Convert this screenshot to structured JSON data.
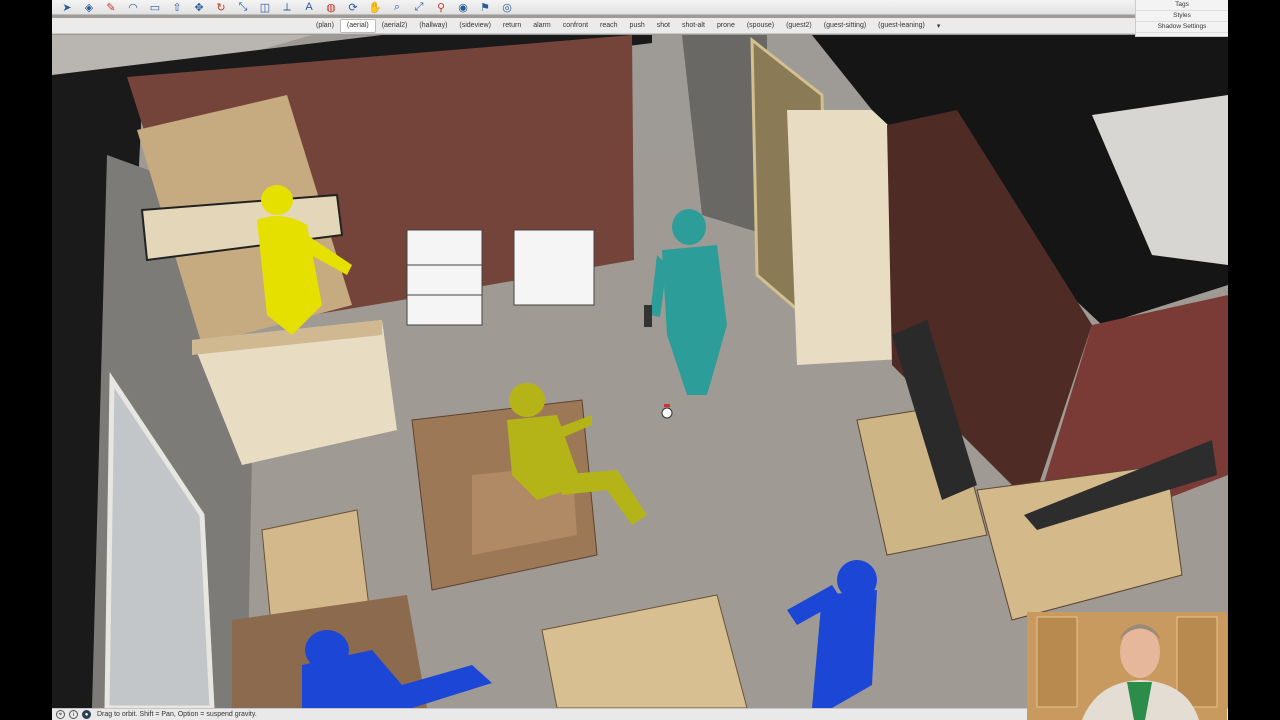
{
  "toolbar": {
    "icons": [
      "select-icon",
      "eraser-icon",
      "pencil-icon",
      "arc-icon",
      "rectangle-icon",
      "push-pull-icon",
      "move-icon",
      "rotate-icon",
      "scale-icon",
      "offset-icon",
      "tape-measure-icon",
      "text-icon",
      "paint-icon",
      "orbit-icon",
      "pan-icon",
      "zoom-icon",
      "zoom-extents-icon",
      "walk-icon",
      "look-around-icon",
      "position-camera-icon",
      "section-plane-icon"
    ]
  },
  "scene_tabs": [
    {
      "label": "(plan)",
      "active": false
    },
    {
      "label": "(aerial)",
      "active": true
    },
    {
      "label": "(aerial2)",
      "active": false
    },
    {
      "label": "(hallway)",
      "active": false
    },
    {
      "label": "(sideview)",
      "active": false
    },
    {
      "label": "return",
      "active": false
    },
    {
      "label": "alarm",
      "active": false
    },
    {
      "label": "confront",
      "active": false
    },
    {
      "label": "reach",
      "active": false
    },
    {
      "label": "push",
      "active": false
    },
    {
      "label": "shot",
      "active": false
    },
    {
      "label": "shot-alt",
      "active": false
    },
    {
      "label": "prone",
      "active": false
    },
    {
      "label": "(spouse)",
      "active": false
    },
    {
      "label": "(guest2)",
      "active": false
    },
    {
      "label": "(guest-sitting)",
      "active": false
    },
    {
      "label": "(guest-leaning)",
      "active": false
    }
  ],
  "scene_tabs_menu": "▾",
  "tray": {
    "items": [
      "Tags",
      "Styles",
      "Shadow Settings"
    ]
  },
  "status": {
    "message": "Drag to orbit. Shift = Pan, Option = suspend gravity."
  },
  "colors": {
    "floor": "#a09a94",
    "wall_brown": "#74433a",
    "wall_gray": "#7d7b78",
    "cream": "#e8dcc2",
    "tan": "#c7a97c",
    "couch": "#9c7856",
    "figure_yellow": "#e6e000",
    "figure_olive": "#b4b418",
    "figure_teal": "#2d9d9a",
    "figure_blue": "#1c46d6"
  }
}
